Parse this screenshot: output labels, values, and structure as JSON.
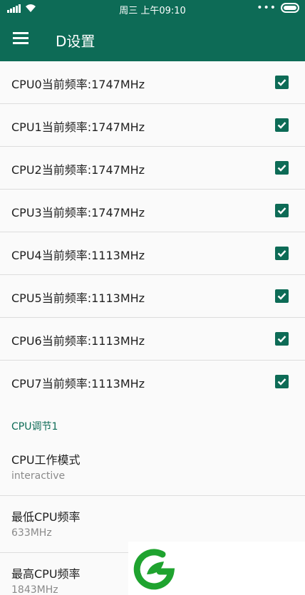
{
  "status_bar": {
    "time": "周三 上午09:10",
    "dots": "•••"
  },
  "app_bar": {
    "title": "D设置"
  },
  "cpu_items": [
    {
      "label": "CPU0当前频率:1747MHz",
      "checked": true
    },
    {
      "label": "CPU1当前频率:1747MHz",
      "checked": true
    },
    {
      "label": "CPU2当前频率:1747MHz",
      "checked": true
    },
    {
      "label": "CPU3当前频率:1747MHz",
      "checked": true
    },
    {
      "label": "CPU4当前频率:1113MHz",
      "checked": true
    },
    {
      "label": "CPU5当前频率:1113MHz",
      "checked": true
    },
    {
      "label": "CPU6当前频率:1113MHz",
      "checked": true
    },
    {
      "label": "CPU7当前频率:1113MHz",
      "checked": true
    }
  ],
  "section": {
    "title": "CPU调节1"
  },
  "preferences": [
    {
      "title": "CPU工作模式",
      "summary": "interactive"
    },
    {
      "title": "最低CPU频率",
      "summary": "633MHz"
    },
    {
      "title": "最高CPU频率",
      "summary": "1843MHz"
    }
  ],
  "colors": {
    "primary": "#0d6b56",
    "accent_text": "#0d6b56",
    "logo_green": "#1fa32f"
  },
  "icons": {
    "menu": "hamburger-icon",
    "checkbox": "checkbox-checked-icon",
    "logo": "leaf-logo"
  }
}
